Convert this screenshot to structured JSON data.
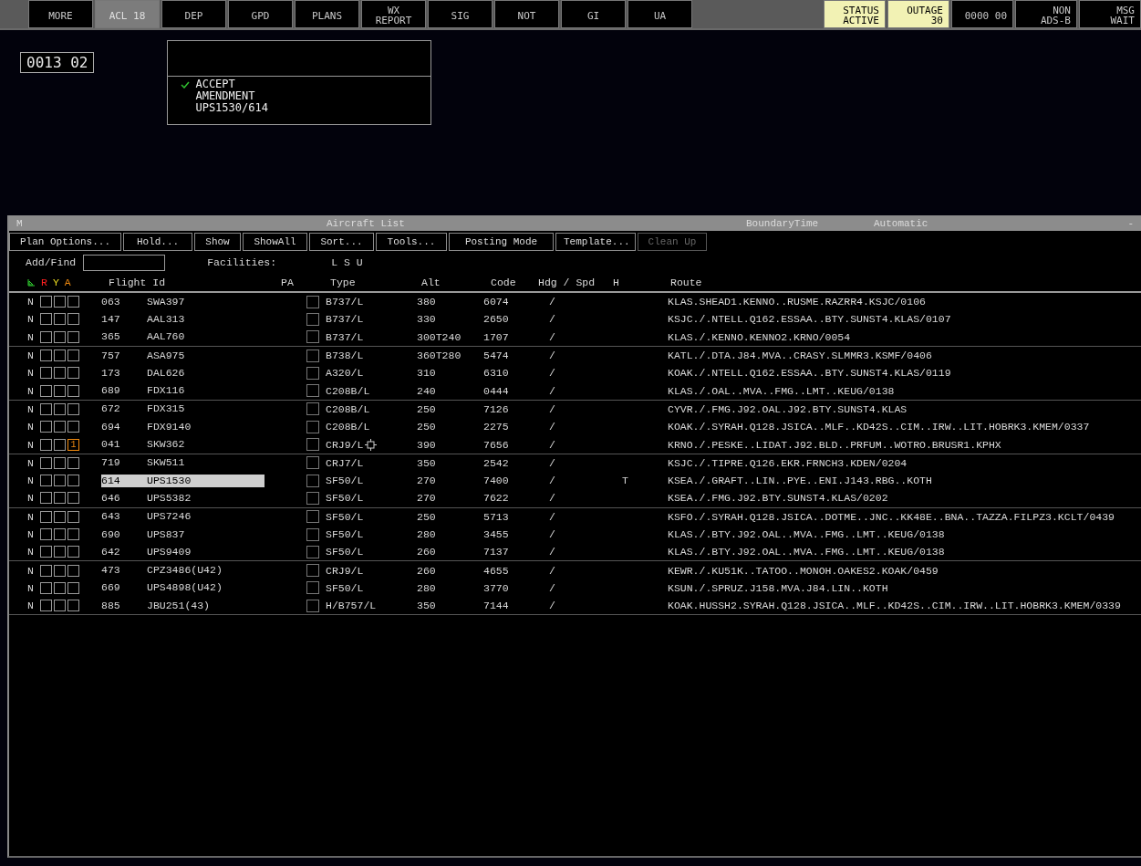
{
  "top_bar": {
    "left_buttons": [
      {
        "label": "MORE",
        "selected": false
      },
      {
        "label": "ACL 18",
        "selected": true
      },
      {
        "label": "DEP",
        "selected": false
      },
      {
        "label": "GPD",
        "selected": false
      },
      {
        "label": "PLANS",
        "selected": false
      },
      {
        "label": "WX\nREPORT",
        "selected": false
      },
      {
        "label": "SIG",
        "selected": false
      },
      {
        "label": "NOT",
        "selected": false
      },
      {
        "label": "GI",
        "selected": false
      },
      {
        "label": "UA",
        "selected": false
      }
    ],
    "right_buttons": [
      {
        "label": "STATUS\nACTIVE",
        "highlighted": true
      },
      {
        "label": "OUTAGE\n30",
        "highlighted": true
      },
      {
        "label": "0000 00",
        "highlighted": false
      },
      {
        "label": "NON\nADS-B",
        "highlighted": false
      },
      {
        "label": "MSG\nWAIT",
        "highlighted": false
      }
    ]
  },
  "time_display": "0013 02",
  "message_box": {
    "lines": [
      {
        "text": "ACCEPT",
        "checked": true
      },
      {
        "text": "AMENDMENT",
        "checked": false
      },
      {
        "text": "UPS1530/614",
        "checked": false
      }
    ]
  },
  "aircraft_list": {
    "menu_letter": "M",
    "title": "Aircraft List",
    "sort_label": "BoundaryTime",
    "posting_mode": "Automatic",
    "minimize": "-",
    "toolbar": [
      {
        "label": "Plan Options...",
        "disabled": false
      },
      {
        "label": "Hold...",
        "disabled": false
      },
      {
        "label": "Show",
        "disabled": false
      },
      {
        "label": "ShowAll",
        "disabled": false
      },
      {
        "label": "Sort...",
        "disabled": false
      },
      {
        "label": "Tools...",
        "disabled": false
      },
      {
        "label": "Posting Mode",
        "disabled": false
      },
      {
        "label": "Template...",
        "disabled": false
      },
      {
        "label": "Clean Up",
        "disabled": true
      }
    ],
    "add_find": {
      "label": "Add/Find"
    },
    "facilities": {
      "label": "Facilities:",
      "value": "L S U"
    },
    "legend": [
      {
        "label": "R",
        "color": "#ff2020"
      },
      {
        "label": "Y",
        "color": "#f0e020"
      },
      {
        "label": "A",
        "color": "#f08a10"
      }
    ],
    "columns": [
      "Flight Id",
      "PA",
      "Type",
      "Alt",
      "Code",
      "Hdg / Spd",
      "H",
      "Route"
    ],
    "groups": [
      {
        "rows": [
          {
            "status": "N",
            "cid": "063",
            "flight_id": "SWA397",
            "checked": false,
            "type": "B737/L",
            "targeted": false,
            "alt": "380",
            "code": "6074",
            "hdg_spd": "/",
            "route": "KLAS.SHEAD1.KENNO..RUSME.RAZRR4.KSJC/0106",
            "selected": false
          },
          {
            "status": "N",
            "cid": "147",
            "flight_id": "AAL313",
            "checked": false,
            "type": "B737/L",
            "targeted": false,
            "alt": "330",
            "code": "2650",
            "hdg_spd": "/",
            "route": "KSJC./.NTELL.Q162.ESSAA..BTY.SUNST4.KLAS/0107",
            "selected": false
          },
          {
            "status": "N",
            "cid": "365",
            "flight_id": "AAL760",
            "checked": false,
            "type": "B737/L",
            "targeted": false,
            "alt": "300T240",
            "code": "1707",
            "hdg_spd": "/",
            "route": "KLAS./.KENNO.KENNO2.KRNO/0054",
            "selected": false
          }
        ]
      },
      {
        "rows": [
          {
            "status": "N",
            "cid": "757",
            "flight_id": "ASA975",
            "checked": false,
            "type": "B738/L",
            "targeted": false,
            "alt": "360T280",
            "code": "5474",
            "hdg_spd": "/",
            "route": "KATL./.DTA.J84.MVA..CRASY.SLMMR3.KSMF/0406",
            "selected": false
          },
          {
            "status": "N",
            "cid": "173",
            "flight_id": "DAL626",
            "checked": false,
            "type": "A320/L",
            "targeted": false,
            "alt": "310",
            "code": "6310",
            "hdg_spd": "/",
            "route": "KOAK./.NTELL.Q162.ESSAA..BTY.SUNST4.KLAS/0119",
            "selected": false
          },
          {
            "status": "N",
            "cid": "689",
            "flight_id": "FDX116",
            "checked": false,
            "type": "C208B/L",
            "targeted": false,
            "alt": "240",
            "code": "0444",
            "hdg_spd": "/",
            "route": "KLAS./.OAL..MVA..FMG..LMT..KEUG/0138",
            "selected": false
          }
        ]
      },
      {
        "rows": [
          {
            "status": "N",
            "cid": "672",
            "flight_id": "FDX315",
            "checked": false,
            "type": "C208B/L",
            "targeted": false,
            "alt": "250",
            "code": "7126",
            "hdg_spd": "/",
            "route": "CYVR./.FMG.J92.OAL.J92.BTY.SUNST4.KLAS",
            "selected": false
          },
          {
            "status": "N",
            "cid": "694",
            "flight_id": "FDX9140",
            "checked": false,
            "type": "C208B/L",
            "targeted": false,
            "alt": "250",
            "code": "2275",
            "hdg_spd": "/",
            "route": "KOAK./.SYRAH.Q128.JSICA..MLF..KD42S..CIM..IRW..LIT.HOBRK3.KMEM/0337",
            "selected": false
          },
          {
            "status": "N",
            "a_count": "1",
            "cid": "041",
            "flight_id": "SKW362",
            "checked": false,
            "type": "CRJ9/L",
            "targeted": true,
            "alt": "390",
            "code": "7656",
            "hdg_spd": "/",
            "route": "KRNO./.PESKE..LIDAT.J92.BLD..PRFUM..WOTRO.BRUSR1.KPHX",
            "selected": false
          }
        ]
      },
      {
        "rows": [
          {
            "status": "N",
            "cid": "719",
            "flight_id": "SKW511",
            "checked": false,
            "type": "CRJ7/L",
            "targeted": false,
            "alt": "350",
            "code": "2542",
            "hdg_spd": "/",
            "route": "KSJC./.TIPRE.Q126.EKR.FRNCH3.KDEN/0204",
            "selected": false
          },
          {
            "status": "N",
            "cid": "614",
            "flight_id": "UPS1530",
            "checked": false,
            "type": "SF50/L",
            "targeted": false,
            "alt": "270",
            "code": "7400",
            "hdg_spd": "/",
            "h": "T",
            "route": "KSEA./.GRAFT..LIN..PYE..ENI.J143.RBG..KOTH",
            "selected": true
          },
          {
            "status": "N",
            "cid": "646",
            "flight_id": "UPS5382",
            "checked": false,
            "type": "SF50/L",
            "targeted": false,
            "alt": "270",
            "code": "7622",
            "hdg_spd": "/",
            "route": "KSEA./.FMG.J92.BTY.SUNST4.KLAS/0202",
            "selected": false
          }
        ]
      },
      {
        "rows": [
          {
            "status": "N",
            "cid": "643",
            "flight_id": "UPS7246",
            "checked": false,
            "type": "SF50/L",
            "targeted": false,
            "alt": "250",
            "code": "5713",
            "hdg_spd": "/",
            "route": "KSFO./.SYRAH.Q128.JSICA..DOTME..JNC..KK48E..BNA..TAZZA.FILPZ3.KCLT/0439",
            "selected": false
          },
          {
            "status": "N",
            "cid": "690",
            "flight_id": "UPS837",
            "checked": false,
            "type": "SF50/L",
            "targeted": false,
            "alt": "280",
            "code": "3455",
            "hdg_spd": "/",
            "route": "KLAS./.BTY.J92.OAL..MVA..FMG..LMT..KEUG/0138",
            "selected": false
          },
          {
            "status": "N",
            "cid": "642",
            "flight_id": "UPS9409",
            "checked": false,
            "type": "SF50/L",
            "targeted": false,
            "alt": "260",
            "code": "7137",
            "hdg_spd": "/",
            "route": "KLAS./.BTY.J92.OAL..MVA..FMG..LMT..KEUG/0138",
            "selected": false
          }
        ]
      },
      {
        "rows": [
          {
            "status": "N",
            "cid": "473",
            "flight_id": "CPZ3486(U42)",
            "checked": false,
            "type": "CRJ9/L",
            "targeted": false,
            "alt": "260",
            "code": "4655",
            "hdg_spd": "/",
            "route": "KEWR./.KU51K..TATOO..MONOH.OAKES2.KOAK/0459",
            "selected": false
          },
          {
            "status": "N",
            "cid": "669",
            "flight_id": "UPS4898(U42)",
            "checked": false,
            "type": "SF50/L",
            "targeted": false,
            "alt": "280",
            "code": "3770",
            "hdg_spd": "/",
            "route": "KSUN./.SPRUZ.J158.MVA.J84.LIN..KOTH",
            "selected": false
          },
          {
            "status": "N",
            "cid": "885",
            "flight_id": "JBU251(43)",
            "checked": false,
            "type": "H/B757/L",
            "targeted": false,
            "alt": "350",
            "code": "7144",
            "hdg_spd": "/",
            "route": "KOAK.HUSSH2.SYRAH.Q128.JSICA..MLF..KD42S..CIM..IRW..LIT.HOBRK3.KMEM/0339",
            "selected": false
          }
        ]
      }
    ]
  }
}
